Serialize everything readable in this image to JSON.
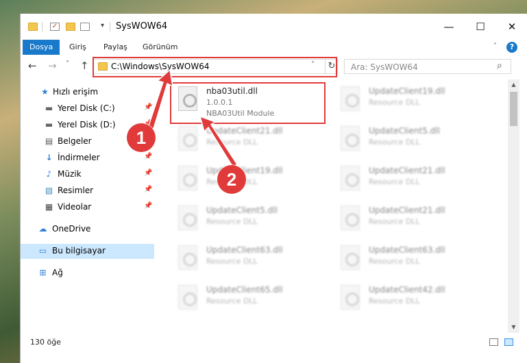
{
  "window": {
    "title": "SysWOW64",
    "minimize_glyph": "—",
    "maximize_glyph": "☐",
    "close_glyph": "✕"
  },
  "quick_access_toolbar": {
    "dropdown_glyph": "▾"
  },
  "ribbon": {
    "tabs": [
      {
        "label": "Dosya",
        "active": true
      },
      {
        "label": "Giriş"
      },
      {
        "label": "Paylaş"
      },
      {
        "label": "Görünüm"
      }
    ],
    "expand_glyph": "˅",
    "help_glyph": "?"
  },
  "navigation": {
    "back_glyph": "←",
    "forward_glyph": "→",
    "recent_glyph": "˅",
    "up_glyph": "↑",
    "address": "C:\\Windows\\SysWOW64",
    "address_dropdown_glyph": "˅",
    "refresh_glyph": "↻",
    "search_placeholder": "Ara: SysWOW64",
    "search_glyph": "⌕"
  },
  "sidebar": {
    "items": [
      {
        "label": "Hızlı erişim",
        "icon": "star-icon",
        "glyph": "★"
      },
      {
        "label": "Yerel Disk (C:)",
        "icon": "drive-icon",
        "glyph": "▬",
        "pinned": true
      },
      {
        "label": "Yerel Disk (D:)",
        "icon": "drive-icon",
        "glyph": "▬",
        "pinned": true
      },
      {
        "label": "Belgeler",
        "icon": "document-icon",
        "glyph": "▤",
        "pinned": true
      },
      {
        "label": "İndirmeler",
        "icon": "download-icon",
        "glyph": "↓",
        "pinned": true
      },
      {
        "label": "Müzik",
        "icon": "music-icon",
        "glyph": "♪",
        "pinned": true
      },
      {
        "label": "Resimler",
        "icon": "pictures-icon",
        "glyph": "▧",
        "pinned": true
      },
      {
        "label": "Videolar",
        "icon": "video-icon",
        "glyph": "▦",
        "pinned": true
      },
      {
        "label": "OneDrive",
        "icon": "cloud-icon",
        "glyph": "☁"
      },
      {
        "label": "Bu bilgisayar",
        "icon": "computer-icon",
        "glyph": "▭",
        "selected": true
      },
      {
        "label": "Ağ",
        "icon": "network-icon",
        "glyph": "⊞"
      }
    ],
    "pin_glyph": "📌"
  },
  "files": {
    "highlighted": {
      "name": "nba03util.dll",
      "version": "1.0.0.1",
      "description": "NBA03Util Module"
    },
    "others": [
      {
        "name": "UpdateClient19.dll",
        "type": "Resource DLL"
      },
      {
        "name": "UpdateClient21.dll",
        "type": "Resource DLL"
      },
      {
        "name": "UpdateClient5.dll",
        "type": "Resource DLL"
      },
      {
        "name": "UpdateClient19.dll",
        "type": "Resource DLL"
      },
      {
        "name": "UpdateClient21.dll",
        "type": "Resource DLL"
      },
      {
        "name": "UpdateClient5.dll",
        "type": "Resource DLL"
      },
      {
        "name": "UpdateClient21.dll",
        "type": "Resource DLL"
      },
      {
        "name": "UpdateClient63.dll",
        "type": "Resource DLL"
      },
      {
        "name": "UpdateClient63.dll",
        "type": "Resource DLL"
      },
      {
        "name": "UpdateClient65.dll",
        "type": "Resource DLL"
      },
      {
        "name": "UpdateClient42.dll",
        "type": "Resource DLL"
      }
    ]
  },
  "status": {
    "item_count": "130 öğe"
  },
  "annotations": {
    "badge1": "1",
    "badge2": "2",
    "color": "#e03a3a"
  }
}
